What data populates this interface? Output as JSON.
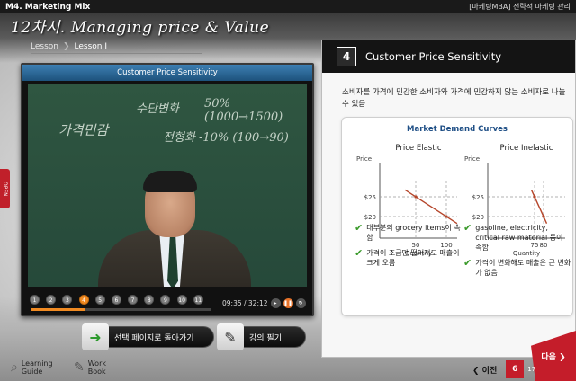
{
  "header": {
    "course_title": "M4. Marketing Mix",
    "category": "[마케팅MBA] 전략적 마케팅 관리",
    "lesson_title": "12차시. Managing price & Value"
  },
  "breadcrumb": {
    "root": "Lesson",
    "sep": "❯",
    "current": "Lesson I"
  },
  "video": {
    "title": "Customer Price Sensitivity",
    "chalk_lines": [
      "50% (1000→1500)",
      "가격민감",
      "수단변화",
      "전형화 -10% (100→90)"
    ],
    "chapters": [
      "1",
      "2",
      "3",
      "4",
      "5",
      "6",
      "7",
      "8",
      "9",
      "10",
      "11"
    ],
    "active_chapter": "4",
    "progress": 0.3,
    "time": "09:35 / 32:12",
    "pause_icon": "pause-icon",
    "repeat_icon": "repeat-icon"
  },
  "buttons": {
    "goto_label": "선택 페이지로 돌아가기",
    "notes_label": "강의 필기"
  },
  "guide": {
    "learning_label_1": "Learning",
    "learning_label_2": "Guide",
    "work_label_1": "Work",
    "work_label_2": "Book"
  },
  "open_tab": "OPEN",
  "content": {
    "number": "4",
    "title": "Customer Price Sensitivity",
    "description": "소비자를 가격에 민감한 소비자와 가격에 민감하지 않는 소비자로 나눌 수 있음"
  },
  "chart_data": [
    {
      "type": "line",
      "title": "Price Elastic",
      "card_title": "Market Demand Curves",
      "xlabel": "Quantity",
      "ylabel": "Price",
      "yticks": [
        "$25",
        "$20"
      ],
      "xticks": [
        "50",
        "100"
      ],
      "series": [
        {
          "x": [
            50,
            100
          ],
          "y": [
            25,
            20
          ]
        }
      ]
    },
    {
      "type": "line",
      "title": "Price Inelastic",
      "xlabel": "Quantity",
      "ylabel": "Price",
      "yticks": [
        "$25",
        "$20"
      ],
      "xticks": [
        "75",
        "80"
      ],
      "series": [
        {
          "x": [
            75,
            80
          ],
          "y": [
            25,
            20
          ]
        }
      ]
    }
  ],
  "bullets": {
    "left": [
      "대부분의 grocery items이 속함",
      "가격이 조금만 떨어져도 매출이 크게 오름"
    ],
    "right": [
      "gasoline, electricity, critical raw material 등이 속함",
      "가격이 변화해도 매출은 큰 변화가 없음"
    ]
  },
  "pagination": {
    "prev_label": "❮ 이전",
    "current_page": "6",
    "total_pages": "17",
    "next_label": "다음 ❯"
  },
  "colors": {
    "accent_orange": "#f08a22",
    "accent_red": "#c41d2a",
    "check_green": "#3a9a2a",
    "curve_color": "#b5452a",
    "video_title_blue": "#2a6a9c"
  }
}
